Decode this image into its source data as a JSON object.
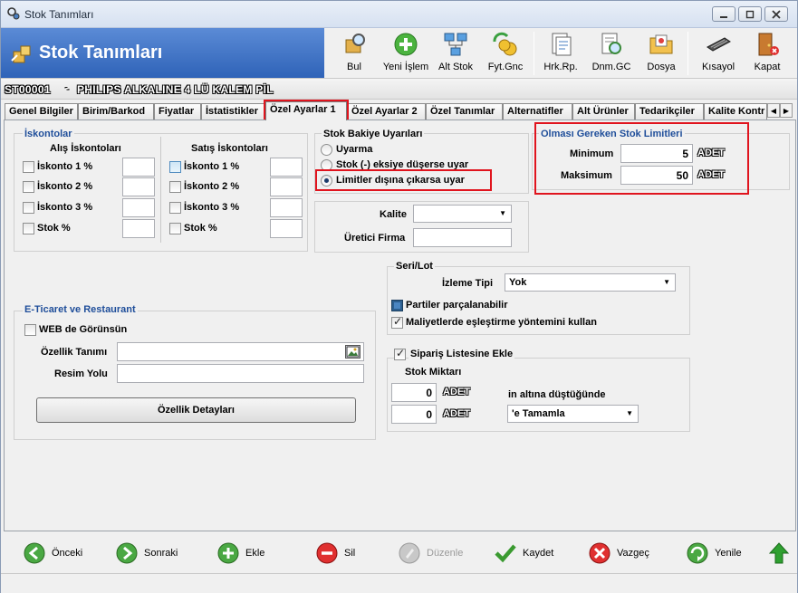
{
  "window": {
    "title": "Stok Tanımları"
  },
  "header": {
    "title": "Stok Tanımları"
  },
  "toolbar": [
    {
      "label": "Bul"
    },
    {
      "label": "Yeni İşlem"
    },
    {
      "label": "Alt Stok"
    },
    {
      "label": "Fyt.Gnc"
    },
    {
      "label": "Hrk.Rp."
    },
    {
      "label": "Dnm.GC"
    },
    {
      "label": "Dosya"
    },
    {
      "label": "Kısayol"
    },
    {
      "label": "Kapat"
    }
  ],
  "record": {
    "code": "ST00001",
    "separator": "-",
    "name": "PHILIPS ALKALINE 4 LÜ KALEM PİL"
  },
  "tabs": [
    {
      "label": "Genel Bilgiler"
    },
    {
      "label": "Birim/Barkod"
    },
    {
      "label": "Fiyatlar"
    },
    {
      "label": "İstatistikler"
    },
    {
      "label": "Özel Ayarlar 1"
    },
    {
      "label": "Özel Ayarlar 2"
    },
    {
      "label": "Özel Tanımlar"
    },
    {
      "label": "Alternatifler"
    },
    {
      "label": "Alt Ürünler"
    },
    {
      "label": "Tedarikçiler"
    },
    {
      "label": "Kalite Kontr"
    }
  ],
  "iskontolar": {
    "title": "İskontolar",
    "alis_title": "Alış İskontoları",
    "satis_title": "Satış İskontoları",
    "alis_items": [
      {
        "label": "İskonto 1 %",
        "value": ""
      },
      {
        "label": "İskonto 2 %",
        "value": ""
      },
      {
        "label": "İskonto 3 %",
        "value": ""
      },
      {
        "label": "Stok %",
        "value": ""
      }
    ],
    "satis_items": [
      {
        "label": "İskonto 1 %",
        "value": ""
      },
      {
        "label": "İskonto 2 %",
        "value": ""
      },
      {
        "label": "İskonto 3 %",
        "value": ""
      },
      {
        "label": "Stok %",
        "value": ""
      }
    ]
  },
  "stok_bakiye": {
    "title": "Stok Bakiye Uyarıları",
    "options": [
      {
        "label": "Uyarma"
      },
      {
        "label": "Stok (-) eksiye düşerse uyar"
      },
      {
        "label": "Limitler dışına çıkarsa uyar"
      }
    ]
  },
  "kalite": {
    "kalite_label": "Kalite",
    "kalite_value": "",
    "uretici_label": "Üretici Firma",
    "uretici_value": ""
  },
  "limitler": {
    "title": "Olması Gereken Stok Limitleri",
    "min_label": "Minimum",
    "min_value": "5",
    "min_unit": "ADET",
    "max_label": "Maksimum",
    "max_value": "50",
    "max_unit": "ADET"
  },
  "seri_lot": {
    "title": "Seri/Lot",
    "izleme_label": "İzleme Tipi",
    "izleme_value": "Yok",
    "partiler_label": "Partiler parçalanabilir",
    "maliyet_label": "Maliyetlerde eşleştirme yöntemini kullan"
  },
  "eticaret": {
    "title": "E-Ticaret ve Restaurant",
    "web_label": "WEB de Görünsün",
    "ozellik_label": "Özellik Tanımı",
    "resim_label": "Resim Yolu",
    "ozellik_value": "",
    "resim_value": "",
    "detay_button": "Özellik Detayları"
  },
  "siparis": {
    "checkbox_label": "Sipariş Listesine Ekle",
    "miktar_label": "Stok Miktarı",
    "miktar1_value": "0",
    "miktar1_unit": "ADET",
    "miktar2_value": "0",
    "miktar2_unit": "ADET",
    "alt_label": "in altına düştüğünde",
    "tamamla_value": "'e Tamamla"
  },
  "footer": [
    {
      "label": "Önceki"
    },
    {
      "label": "Sonraki"
    },
    {
      "label": "Ekle"
    },
    {
      "label": "Sil"
    },
    {
      "label": "Düzenle"
    },
    {
      "label": "Kaydet"
    },
    {
      "label": "Vazgeç"
    },
    {
      "label": "Yenile"
    }
  ]
}
